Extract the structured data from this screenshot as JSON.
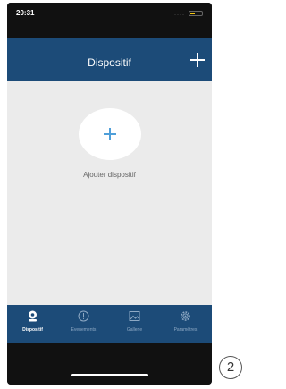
{
  "status_bar": {
    "time": "20:31",
    "battery_level": 0.4,
    "battery_color": "#f2c40f"
  },
  "navbar": {
    "title": "Dispositif",
    "add_icon": "plus-icon",
    "color": "#1c4b78"
  },
  "main": {
    "add_device_label": "Ajouter dispositif",
    "add_icon": "plus-icon",
    "accent": "#4f9fd9"
  },
  "tabs": [
    {
      "label": "Dispositif",
      "icon": "camera-icon",
      "active": true
    },
    {
      "label": "Evenements",
      "icon": "alert-icon",
      "active": false
    },
    {
      "label": "Gallerie",
      "icon": "image-icon",
      "active": false
    },
    {
      "label": "Paramètres",
      "icon": "gear-icon",
      "active": false
    }
  ],
  "page_number": "2"
}
